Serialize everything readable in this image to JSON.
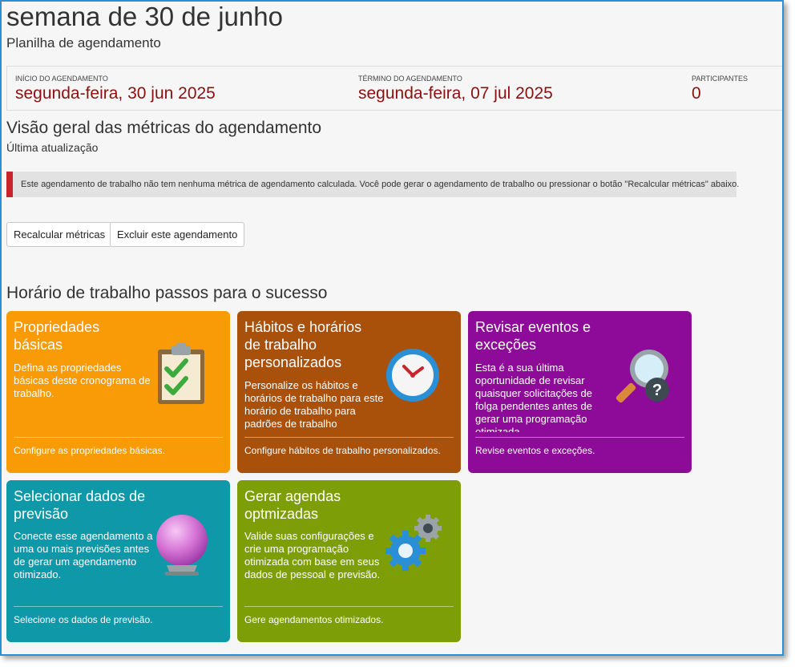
{
  "header": {
    "title": "semana de 30 de junho",
    "subtitle": "Planilha de agendamento"
  },
  "info": {
    "start_label": "INÍCIO DO AGENDAMENTO",
    "start_value": "segunda-feira, 30 jun 2025",
    "end_label": "TÉRMINO DO AGENDAMENTO",
    "end_value": "segunda-feira, 07 jul 2025",
    "participants_label": "PARTICIPANTES",
    "participants_value": "0"
  },
  "overview": {
    "title": "Visão geral das métricas do agendamento",
    "subtitle": "Última atualização",
    "alert": "Este agendamento de trabalho não tem nenhuma métrica de agendamento calculada. Você pode gerar o agendamento de trabalho ou pressionar o botão \"Recalcular métricas\" abaixo."
  },
  "buttons": {
    "recalc": "Recalcular métricas",
    "delete": "Excluir este agendamento"
  },
  "steps": {
    "title": "Horário de trabalho passos para o sucesso",
    "cards": [
      {
        "title": "Propriedades básicas",
        "desc": "Defina as propriedades básicas deste cronograma de trabalho.",
        "footer": "Configure as propriedades básicas.",
        "color": "#f99b06",
        "icon": "clipboard-checklist-icon"
      },
      {
        "title": "Hábitos e horários de trabalho personalizados",
        "desc": "Personalize os hábitos e horários de trabalho para este horário de trabalho para padrões de trabalho específicos.",
        "footer": "Configure hábitos de trabalho personalizados.",
        "color": "#a9500b",
        "icon": "clock-icon"
      },
      {
        "title": "Revisar eventos e exceções",
        "desc": "Esta é a sua última oportunidade de revisar quaisquer solicitações de folga pendentes antes de gerar uma programação otimizada.",
        "footer": "Revise eventos e exceções.",
        "color": "#8e0a99",
        "icon": "magnifier-question-icon"
      },
      {
        "title": "Selecionar dados de previsão",
        "desc": "Conecte esse agendamento a uma ou mais previsões antes de gerar um agendamento otimizado.",
        "footer": "Selecione os dados de previsão.",
        "color": "#0e98a8",
        "icon": "crystal-ball-icon"
      },
      {
        "title": "Gerar agendas optmizadas",
        "desc": "Valide suas configurações e crie uma programação otimizada com base em seus dados de pessoal e previsão.",
        "footer": "Gere agendamentos otimizados.",
        "color": "#7d9e07",
        "icon": "gears-icon"
      }
    ]
  }
}
